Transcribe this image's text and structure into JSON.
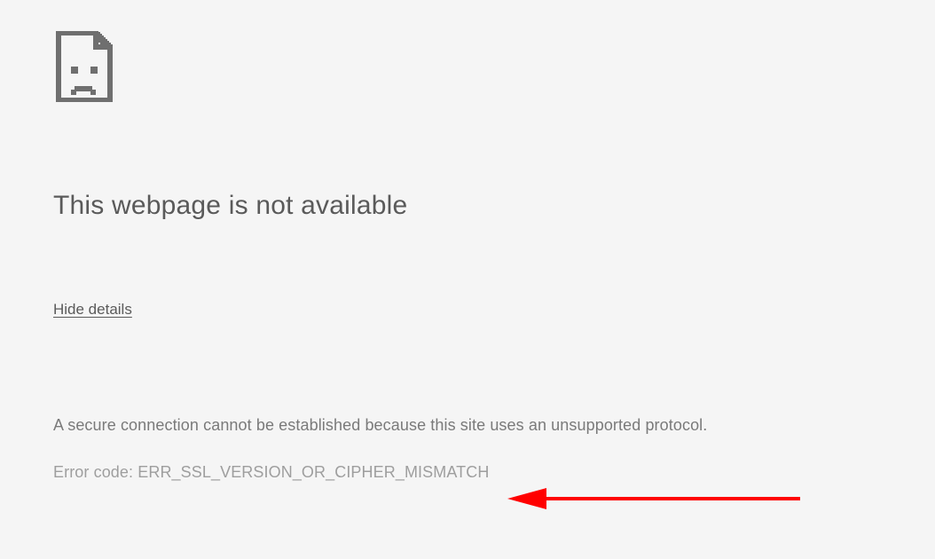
{
  "icon": "sad-file-icon",
  "title": "This webpage is not available",
  "toggle_label": "Hide details",
  "description": "A secure connection cannot be established because this site uses an unsupported protocol.",
  "error_label": "Error code:",
  "error_code": "ERR_SSL_VERSION_OR_CIPHER_MISMATCH",
  "annotation": {
    "color": "#ff0000",
    "target": "error-code"
  }
}
